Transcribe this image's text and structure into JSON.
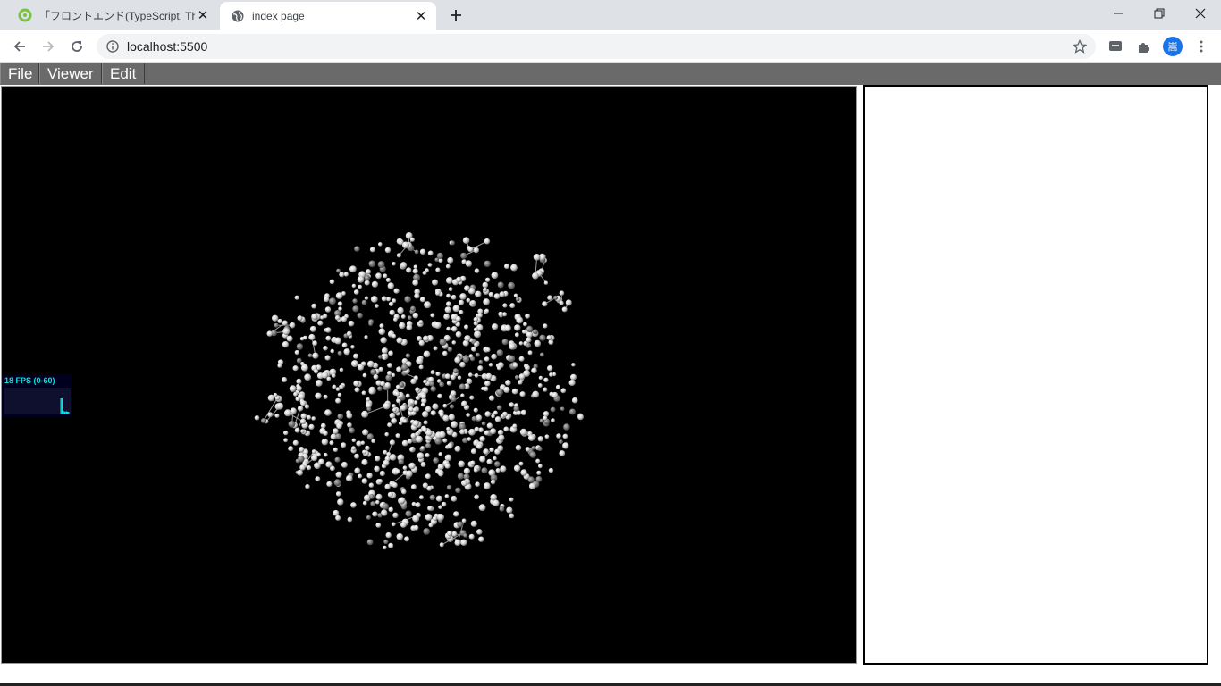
{
  "browser": {
    "tabs": [
      {
        "title": "「フロントエンド(TypeScript, Three.js)",
        "active": false,
        "icon": "green-ring-icon"
      },
      {
        "title": "index page",
        "active": true,
        "icon": "globe-icon"
      }
    ],
    "new_tab_icon": "plus-icon",
    "window_controls": [
      "minimize-icon",
      "restore-icon",
      "close-icon"
    ],
    "address": "localhost:5500",
    "avatar_text": "嵩",
    "colors": {
      "tabstrip": "#dee1e6",
      "avatar": "#1a73e8",
      "accent_green": "#34c759"
    }
  },
  "app": {
    "menu": [
      "File",
      "Viewer",
      "Edit"
    ],
    "stats": {
      "label": "18 FPS (0-60)",
      "color": "#00ffff",
      "bars": [
        0,
        0,
        0,
        0,
        0,
        0,
        0,
        0,
        0,
        0,
        0,
        0,
        0,
        0,
        0,
        0,
        0,
        0,
        0,
        0,
        0,
        0,
        0,
        0,
        0,
        0,
        0,
        0,
        0,
        0,
        0,
        0,
        0,
        0,
        0,
        0,
        0,
        0,
        0,
        0,
        0,
        0,
        0,
        0,
        0,
        0,
        0,
        0,
        0,
        0,
        0.6,
        0.6,
        0.15,
        0.12,
        0.1,
        0.12,
        0.1,
        0.1
      ]
    },
    "viewer": {
      "background": "#000000",
      "atom_color": "#e8e8e8",
      "bond_color": "#9a9a9a"
    }
  }
}
